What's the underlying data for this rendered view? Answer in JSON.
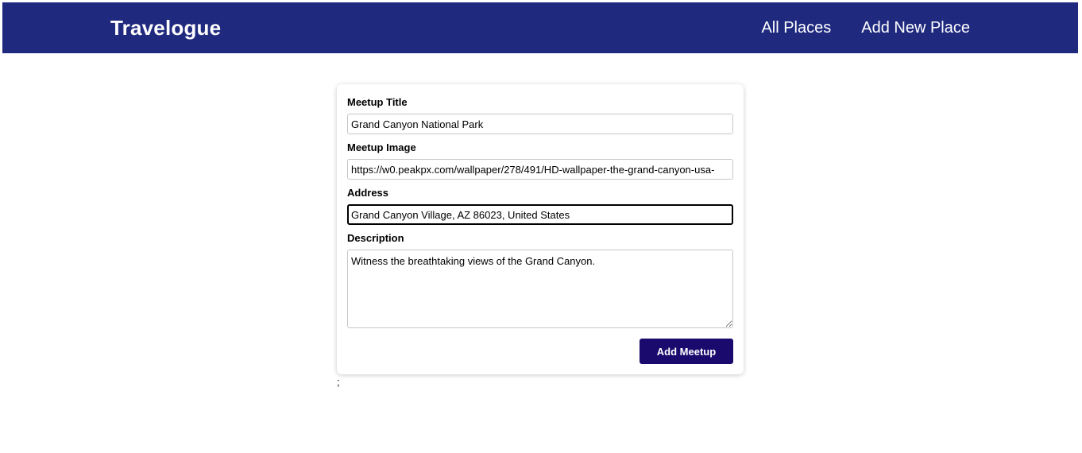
{
  "header": {
    "brand": "Travelogue",
    "background": "#1f2a7f",
    "nav": [
      {
        "label": "All Places"
      },
      {
        "label": "Add New Place"
      }
    ]
  },
  "form": {
    "title": {
      "label": "Meetup Title",
      "value": "Grand Canyon National Park"
    },
    "image": {
      "label": "Meetup Image",
      "value": "https://w0.peakpx.com/wallpaper/278/491/HD-wallpaper-the-grand-canyon-usa-"
    },
    "address": {
      "label": "Address",
      "value": "Grand Canyon Village, AZ 86023, United States"
    },
    "description": {
      "label": "Description",
      "value": "Witness the breathtaking views of the Grand Canyon."
    },
    "submit_label": "Add Meetup",
    "submit_color": "#1b0a6e"
  },
  "footer_text": ";"
}
